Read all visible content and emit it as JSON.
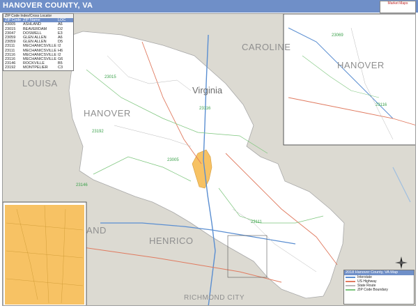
{
  "title": "HANOVER COUNTY, VA",
  "logo_text": "Market Maps",
  "labels": {
    "caroline_top": "CAROLINE",
    "caroline_main": "CAROLINE",
    "louisa": "LOUISA",
    "hanover_main": "HANOVER",
    "hanover_inset": "HANOVER",
    "henrico": "HENRICO",
    "land": "AND",
    "richmond": "RICHMOND CITY",
    "virginia": "Virginia"
  },
  "zip_labels": [
    "23015",
    "23192",
    "23005",
    "23146",
    "23116",
    "23111",
    "23069",
    "23116"
  ],
  "zip_table": {
    "headers": [
      "ZIP Code",
      "ZIP Name",
      "LOC"
    ],
    "title": "ZIP Code Index/Cross Locator",
    "rows": [
      [
        "23005",
        "ASHLAND",
        "A6"
      ],
      [
        "23015",
        "BEAVERDAM",
        "D2"
      ],
      [
        "23047",
        "DOSWELL",
        "E3"
      ],
      [
        "23059",
        "GLEN ALLEN",
        "A6"
      ],
      [
        "23059",
        "GLEN ALLEN",
        "D5"
      ],
      [
        "23111",
        "MECHANICSVILLE",
        "I2"
      ],
      [
        "23111",
        "MECHANICSVILLE",
        "H6"
      ],
      [
        "23116",
        "MECHANICSVILLE",
        "I2"
      ],
      [
        "23116",
        "MECHANICSVILLE",
        "G6"
      ],
      [
        "23146",
        "ROCKVILLE",
        "B5"
      ],
      [
        "23192",
        "MONTPELIER",
        "C3"
      ]
    ]
  },
  "legend": {
    "title": "2018 Hanover County, VA Map",
    "rows": [
      "Interstate",
      "US Highway",
      "State Route",
      "ZIP Code Boundary"
    ]
  },
  "colors": {
    "header": "#6f8fc8",
    "outside_land": "#dcdad2",
    "county_fill": "#ffffff",
    "city_fill": "#f7c264",
    "zip_boundary": "#7bc57b",
    "interstate": "#5a8ed1",
    "highway": "#e07a5f",
    "water": "#9fbfe0"
  }
}
